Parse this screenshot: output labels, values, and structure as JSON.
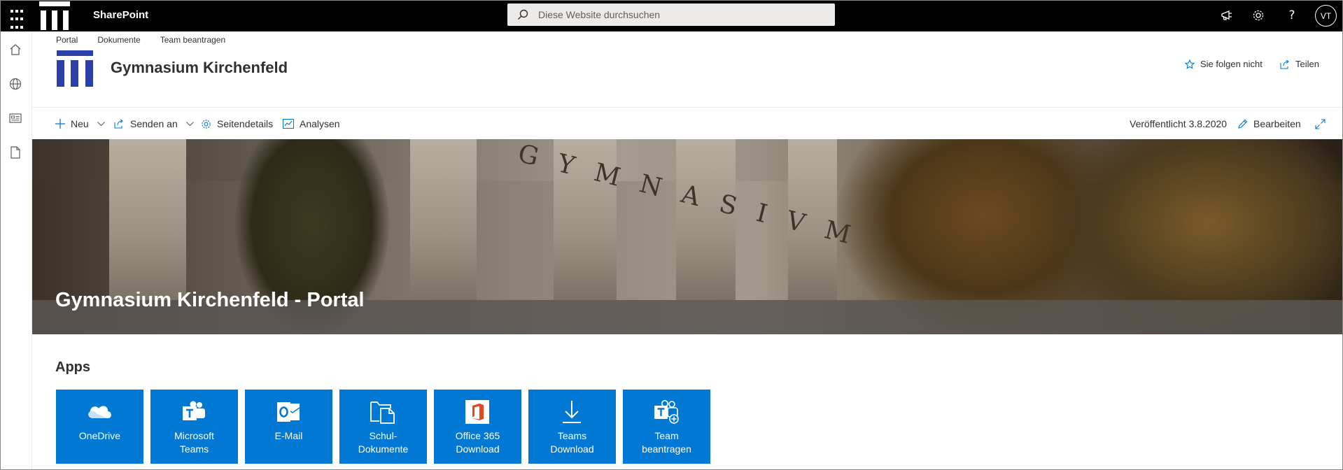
{
  "suite": {
    "app_name": "SharePoint",
    "search_placeholder": "Diese Website durchsuchen",
    "icons": [
      "waffle-icon",
      "megaphone-icon",
      "gear-icon",
      "help-icon"
    ],
    "avatar_initials": "VT"
  },
  "appbar": {
    "icons": [
      "home-icon",
      "globe-icon",
      "news-icon",
      "document-icon"
    ]
  },
  "hubnav": [
    "Portal",
    "Dokumente",
    "Team beantragen"
  ],
  "site": {
    "title": "Gymnasium Kirchenfeld",
    "follow_label": "Sie folgen nicht",
    "share_label": "Teilen"
  },
  "commandbar": {
    "new_label": "Neu",
    "send_label": "Senden an",
    "details_label": "Seitendetails",
    "analytics_label": "Analysen",
    "published_label": "Veröffentlicht 3.8.2020",
    "edit_label": "Bearbeiten"
  },
  "hero": {
    "title": "Gymnasium Kirchenfeld - Portal",
    "carved_text": "GYMNASIVM"
  },
  "apps": {
    "title": "Apps",
    "tiles": [
      {
        "label": "OneDrive",
        "icon": "onedrive-icon"
      },
      {
        "label": "Microsoft\nTeams",
        "icon": "teams-icon"
      },
      {
        "label": "E-Mail",
        "icon": "outlook-icon"
      },
      {
        "label": "Schul-\nDokumente",
        "icon": "documents-icon"
      },
      {
        "label": "Office 365\nDownload",
        "icon": "office-icon"
      },
      {
        "label": "Teams\nDownload",
        "icon": "download-icon"
      },
      {
        "label": "Team\nbeantragen",
        "icon": "teams-add-icon"
      }
    ]
  },
  "colors": {
    "suite_bar": "#000000",
    "brand": "#2b3fa9",
    "tile": "#0078d4",
    "accent_icon": "#0078d4"
  }
}
